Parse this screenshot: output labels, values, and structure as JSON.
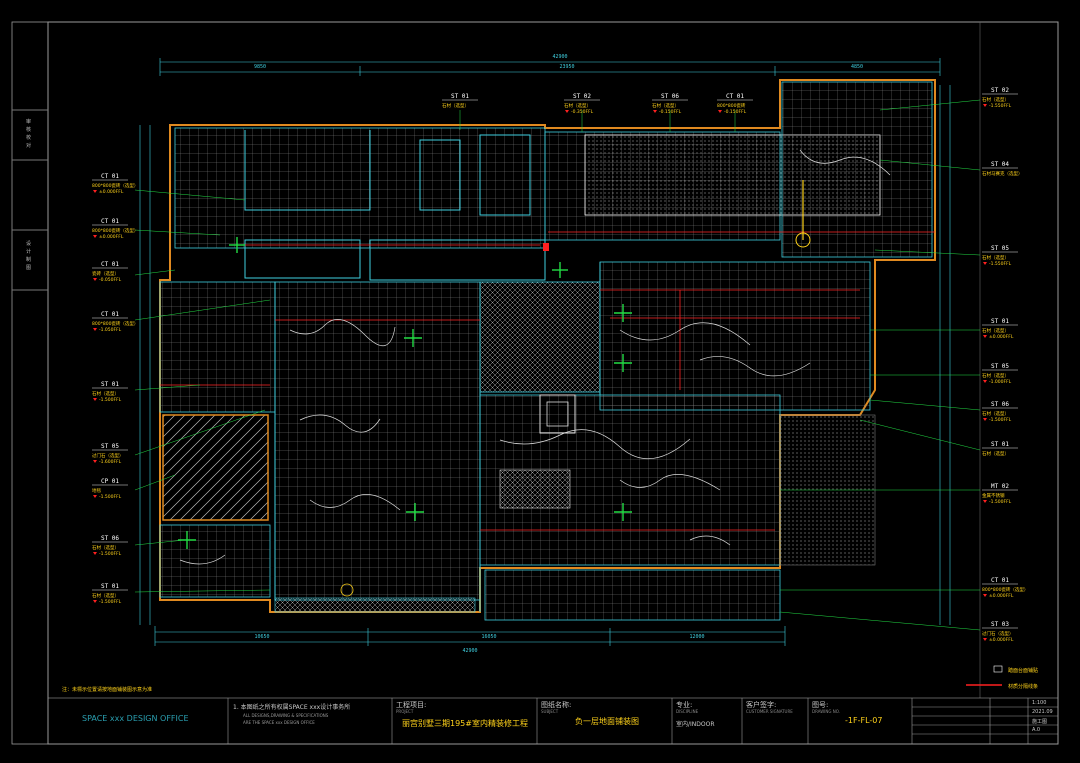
{
  "drawing": {
    "overall_dim_top": "42900",
    "overall_dim_bottom": "42900",
    "top_dims": [
      "9850",
      "23950",
      "4850"
    ],
    "bottom_dims": [
      "10650",
      "16050",
      "12000"
    ],
    "note": "注：未標示位置请按地面铺装图示意为准"
  },
  "legend": {
    "items": [
      {
        "label": "踏面台面铺贴",
        "color": "#ffffff"
      },
      {
        "label": "材质分隔线条",
        "color": "#ff2020"
      }
    ]
  },
  "left_callouts": [
    {
      "code": "CT 01",
      "name": "800*800瓷砖（选型）",
      "level": "±0.000FFL"
    },
    {
      "code": "CT 01",
      "name": "800*800瓷砖（选型）",
      "level": "±0.000FFL"
    },
    {
      "code": "CT 01",
      "name": "瓷砖（选型）",
      "level": "-0.050FFL"
    },
    {
      "code": "CT 01",
      "name": "800*800瓷砖（选型）",
      "level": "-1.050FFL"
    },
    {
      "code": "ST 01",
      "name": "石材（选型）",
      "level": "-1.500FFL"
    },
    {
      "code": "ST 05",
      "name": "过门石（选型）",
      "level": "-1.600FFL"
    },
    {
      "code": "CP 01",
      "name": "地毯",
      "level": "-1.500FFL"
    },
    {
      "code": "ST 06",
      "name": "石材（选型）",
      "level": "-1.500FFL"
    },
    {
      "code": "ST 01",
      "name": "石材（选型）",
      "level": "-1.500FFL"
    }
  ],
  "right_callouts": [
    {
      "code": "ST 02",
      "name": "石材（选型）",
      "level": "-1.550FFL"
    },
    {
      "code": "ST 04",
      "name": "石材马赛克（选型）",
      "level": ""
    },
    {
      "code": "ST 05",
      "name": "石材（选型）",
      "level": "-1.550FFL"
    },
    {
      "code": "ST 01",
      "name": "石材（选型）",
      "level": "±0.000FFL"
    },
    {
      "code": "ST 05",
      "name": "石材（选型）",
      "level": "-1.000FFL"
    },
    {
      "code": "ST 06",
      "name": "石材（选型）",
      "level": "-1.500FFL"
    },
    {
      "code": "ST 01",
      "name": "石材（选型）",
      "level": ""
    },
    {
      "code": "MT 02",
      "name": "金属不锈钢",
      "level": "-1.500FFL"
    },
    {
      "code": "CT 01",
      "name": "800*800瓷砖（选型）",
      "level": "±0.000FFL"
    },
    {
      "code": "ST 03",
      "name": "过门石（选型）",
      "level": "±0.000FFL"
    }
  ],
  "top_callouts": [
    {
      "code": "ST 01",
      "name": "石材（选型）",
      "level": ""
    },
    {
      "code": "ST 02",
      "name": "石材（选型）",
      "level": "-0.350FFL"
    },
    {
      "code": "ST 06",
      "name": "石材（选型）",
      "level": "-0.150FFL"
    },
    {
      "code": "CT 01",
      "name": "800*800瓷砖",
      "level": "-0.150FFL"
    }
  ],
  "title_block": {
    "office": "SPACE xxx DESIGN OFFICE",
    "copyright_cn": "1. 本图纸之所有权属SPACE xxx设计事务所",
    "copyright_en_1": "ALL DESIGNS,DRAWING & SPECIFICATIONS",
    "copyright_en_2": "ARE THE SPACE xxx DESIGN OFFICE",
    "project_label": "工程项目:",
    "project_label_en": "PROJECT",
    "project_name": "丽宫别墅三期195#室内精装修工程",
    "drawing_label": "图纸名称:",
    "drawing_label_en": "SUBJECT",
    "drawing_name": "负一层地面铺装图",
    "discipline_label": "专业:",
    "discipline_label_en": "DISCIPLINE",
    "discipline_value": "室内/INDOOR",
    "client_label": "客户签字:",
    "client_label_en": "CUSTOMER SIGNATURE",
    "number_label": "图号:",
    "number_label_en": "DRAWING NO.",
    "drawing_no": "-1F-FL-07",
    "scale": "1:100",
    "date": "2021.09",
    "sheet": "施工图",
    "version": "A.0"
  },
  "side_strip": {
    "top_labels": [
      "审",
      "核",
      "校",
      "对"
    ],
    "bottom_labels": [
      "设",
      "计",
      "制",
      "图"
    ]
  }
}
